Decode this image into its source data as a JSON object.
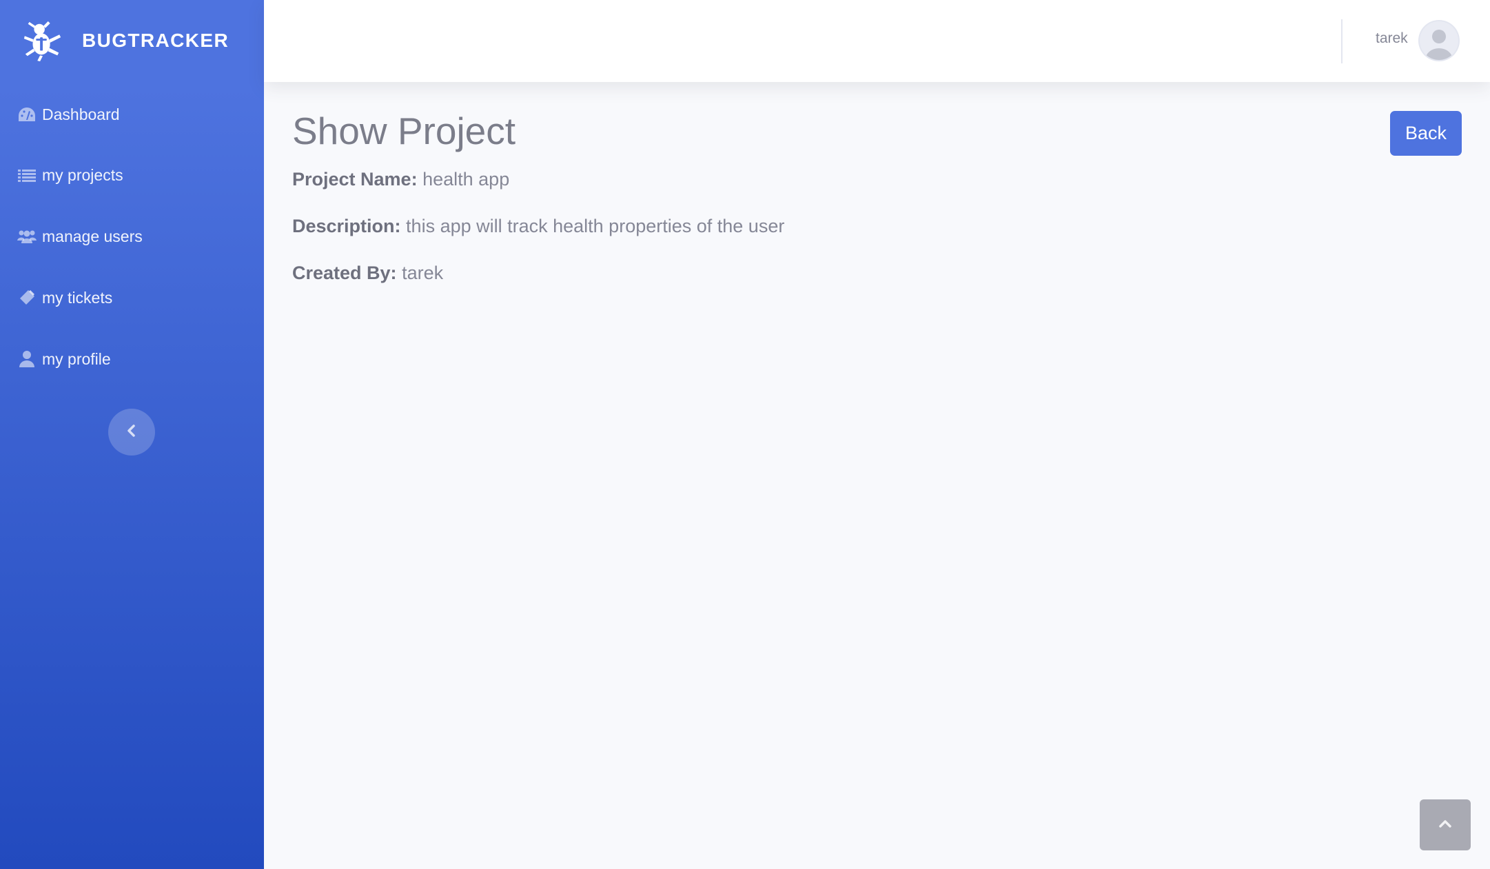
{
  "brand": {
    "name": "BUGTRACKER",
    "icon": "bug-icon"
  },
  "sidebar": {
    "items": [
      {
        "label": "Dashboard",
        "icon": "tachometer-icon"
      },
      {
        "label": "my projects",
        "icon": "list-icon"
      },
      {
        "label": "manage users",
        "icon": "users-icon"
      },
      {
        "label": "my tickets",
        "icon": "ticket-icon"
      },
      {
        "label": "my profile",
        "icon": "user-icon"
      }
    ],
    "toggle_icon": "chevron-left-icon"
  },
  "topbar": {
    "user_name": "tarek",
    "avatar_icon": "user-avatar-icon"
  },
  "page": {
    "title": "Show Project",
    "back_label": "Back",
    "fields": [
      {
        "label": "Project Name:",
        "value": "health app"
      },
      {
        "label": "Description:",
        "value": "this app will track health properties of the user"
      },
      {
        "label": "Created By:",
        "value": "tarek"
      }
    ]
  },
  "scroll_top_icon": "chevron-up-icon",
  "colors": {
    "sidebar_top": "#4e73df",
    "sidebar_bottom": "#224abe",
    "primary": "#4e73df",
    "background": "#f8f9fc"
  }
}
